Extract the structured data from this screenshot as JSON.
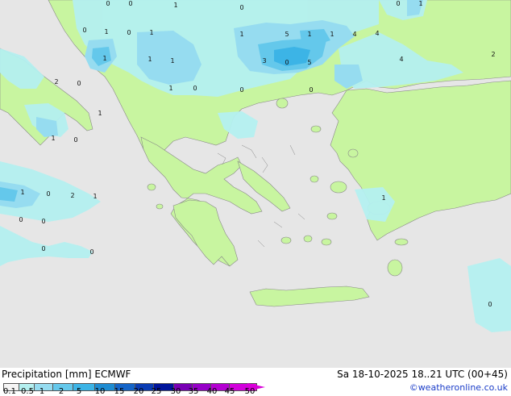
{
  "header": {
    "title_left": "Precipitation [mm] ECMWF",
    "title_right": "Sa 18-10-2025 18..21 UTC (00+45)",
    "credit": "©weatheronline.co.uk"
  },
  "legend": {
    "ticks": [
      "0.1",
      "0.5",
      "1",
      "2",
      "5",
      "10",
      "15",
      "20",
      "25",
      "30",
      "35",
      "40",
      "45",
      "50"
    ],
    "colors": [
      "#f5f5f5",
      "#b4f0f0",
      "#96dcf0",
      "#64c8eb",
      "#3cb4e6",
      "#1e8cd2",
      "#1464c8",
      "#0a3cb4",
      "#00149b",
      "#7800b4",
      "#9600c8",
      "#b400d2",
      "#d200dc",
      "#f000e6"
    ]
  },
  "map": {
    "colors": {
      "sea": "#e6e6e6",
      "land": "#c8f5a0",
      "precip_light": "#b4f0f0",
      "precip_mid": "#96dcf0",
      "precip_heavy": "#64c8eb",
      "precip_max": "#3cb4e6"
    },
    "labels": [
      "0",
      "0",
      "1",
      "0",
      "0",
      "1",
      "0",
      "1",
      "1",
      "5",
      "1",
      "1",
      "4",
      "4",
      "1",
      "1",
      "1",
      "3",
      "0",
      "5",
      "4",
      "2",
      "2",
      "0",
      "1",
      "0",
      "0",
      "0",
      "1",
      "1",
      "0",
      "1",
      "1",
      "0",
      "2",
      "1",
      "0",
      "0",
      "0",
      "0",
      "0",
      "1",
      "0"
    ]
  }
}
